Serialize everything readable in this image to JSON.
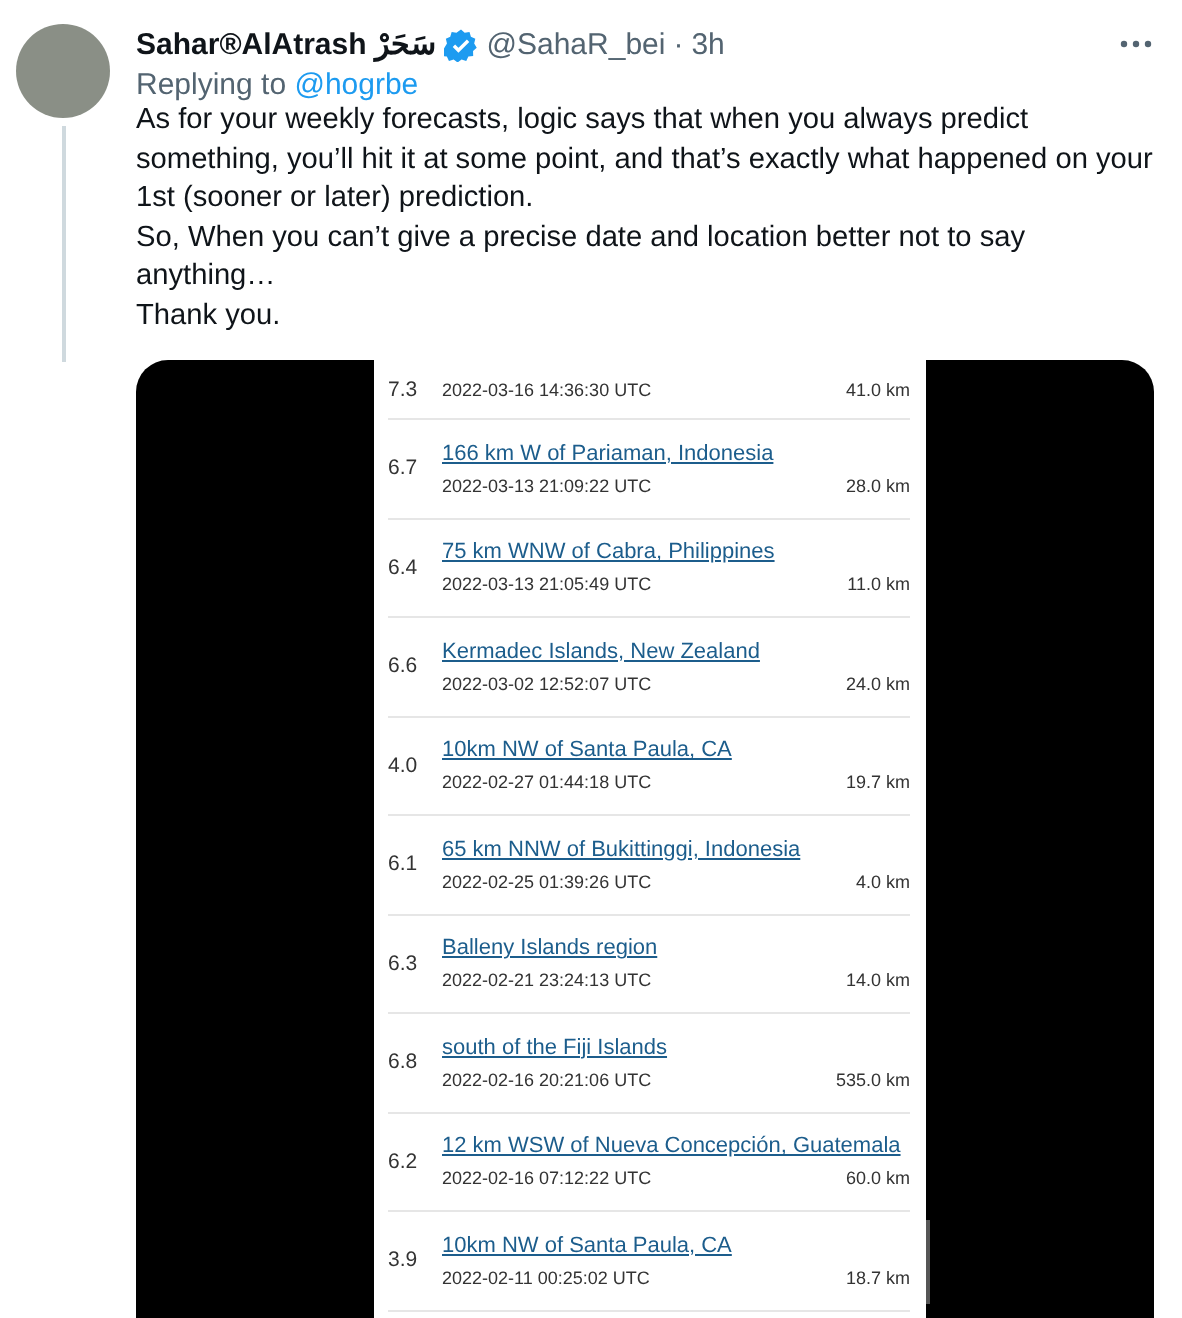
{
  "tweet": {
    "display_name": "Sahar®AlAtrash",
    "arabic_name": "سَحَرْ",
    "verified": true,
    "handle": "@SahaR_bei",
    "separator": "·",
    "time": "3h",
    "replying_label": "Replying to",
    "replying_to": "@hogrbe",
    "paragraphs": [
      "As for your weekly forecasts, logic says that when you always predict something, you’ll hit it at some point, and that’s exactly what happened on your 1st (sooner or later) prediction.",
      "So, When you can’t give a precise date and location better not to say anything…",
      "Thank you."
    ]
  },
  "earthquakes": [
    {
      "kind": "partial",
      "magnitude": "7.3",
      "time": "2022-03-16 14:36:30 UTC",
      "depth": "41.0 km"
    },
    {
      "kind": "full",
      "magnitude": "6.7",
      "location": "166 km W of Pariaman, Indonesia",
      "time": "2022-03-13 21:09:22 UTC",
      "depth": "28.0 km"
    },
    {
      "kind": "full",
      "magnitude": "6.4",
      "location": "75 km WNW of Cabra, Philippines",
      "time": "2022-03-13 21:05:49 UTC",
      "depth": "11.0 km"
    },
    {
      "kind": "full",
      "magnitude": "6.6",
      "location": "Kermadec Islands, New Zealand",
      "time": "2022-03-02 12:52:07 UTC",
      "depth": "24.0 km"
    },
    {
      "kind": "full",
      "magnitude": "4.0",
      "location": "10km NW of Santa Paula, CA",
      "time": "2022-02-27 01:44:18 UTC",
      "depth": "19.7 km"
    },
    {
      "kind": "full",
      "magnitude": "6.1",
      "location": "65 km NNW of Bukittinggi, Indonesia",
      "time": "2022-02-25 01:39:26 UTC",
      "depth": "4.0 km"
    },
    {
      "kind": "full",
      "magnitude": "6.3",
      "location": "Balleny Islands region",
      "time": "2022-02-21 23:24:13 UTC",
      "depth": "14.0 km"
    },
    {
      "kind": "full",
      "magnitude": "6.8",
      "location": "south of the Fiji Islands",
      "time": "2022-02-16 20:21:06 UTC",
      "depth": "535.0 km"
    },
    {
      "kind": "full",
      "magnitude": "6.2",
      "location": "12 km WSW of Nueva Concepción, Guatemala",
      "time": "2022-02-16 07:12:22 UTC",
      "depth": "60.0 km"
    },
    {
      "kind": "full",
      "magnitude": "3.9",
      "location": "10km NW of Santa Paula, CA",
      "time": "2022-02-11 00:25:02 UTC",
      "depth": "18.7 km"
    }
  ]
}
